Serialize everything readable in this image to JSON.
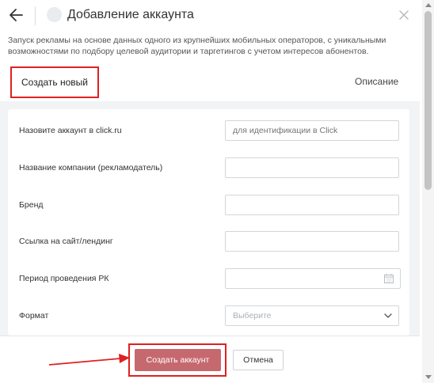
{
  "header": {
    "title": "Добавление аккаунта"
  },
  "description": "Запуск рекламы на основе данных одного из крупнейших мобильных операторов, с уникальными возможностями по подбору целевой аудитории и таргетингов с учетом интересов абонентов.",
  "tabs": {
    "create": "Создать новый",
    "description": "Описание"
  },
  "form": {
    "fields": [
      {
        "label": "Назовите аккаунт в click.ru",
        "placeholder": "для идентификации в Click",
        "value": ""
      },
      {
        "label": "Название компании (рекламодатель)",
        "placeholder": "",
        "value": ""
      },
      {
        "label": "Бренд",
        "placeholder": "",
        "value": ""
      },
      {
        "label": "Ссылка на сайт/лендинг",
        "placeholder": "",
        "value": ""
      },
      {
        "label": "Период проведения РК",
        "placeholder": "",
        "value": ""
      },
      {
        "label": "Формат",
        "placeholder": "Выберите",
        "value": ""
      }
    ]
  },
  "footer": {
    "create_button": "Создать аккаунт",
    "cancel_button": "Отмена"
  },
  "colors": {
    "accent_red": "#e02020",
    "primary_button": "#c6696f"
  },
  "icons": {
    "back": "arrow-left-icon",
    "close": "close-icon",
    "calendar": "calendar-icon",
    "dropdown": "chevron-down-icon"
  }
}
